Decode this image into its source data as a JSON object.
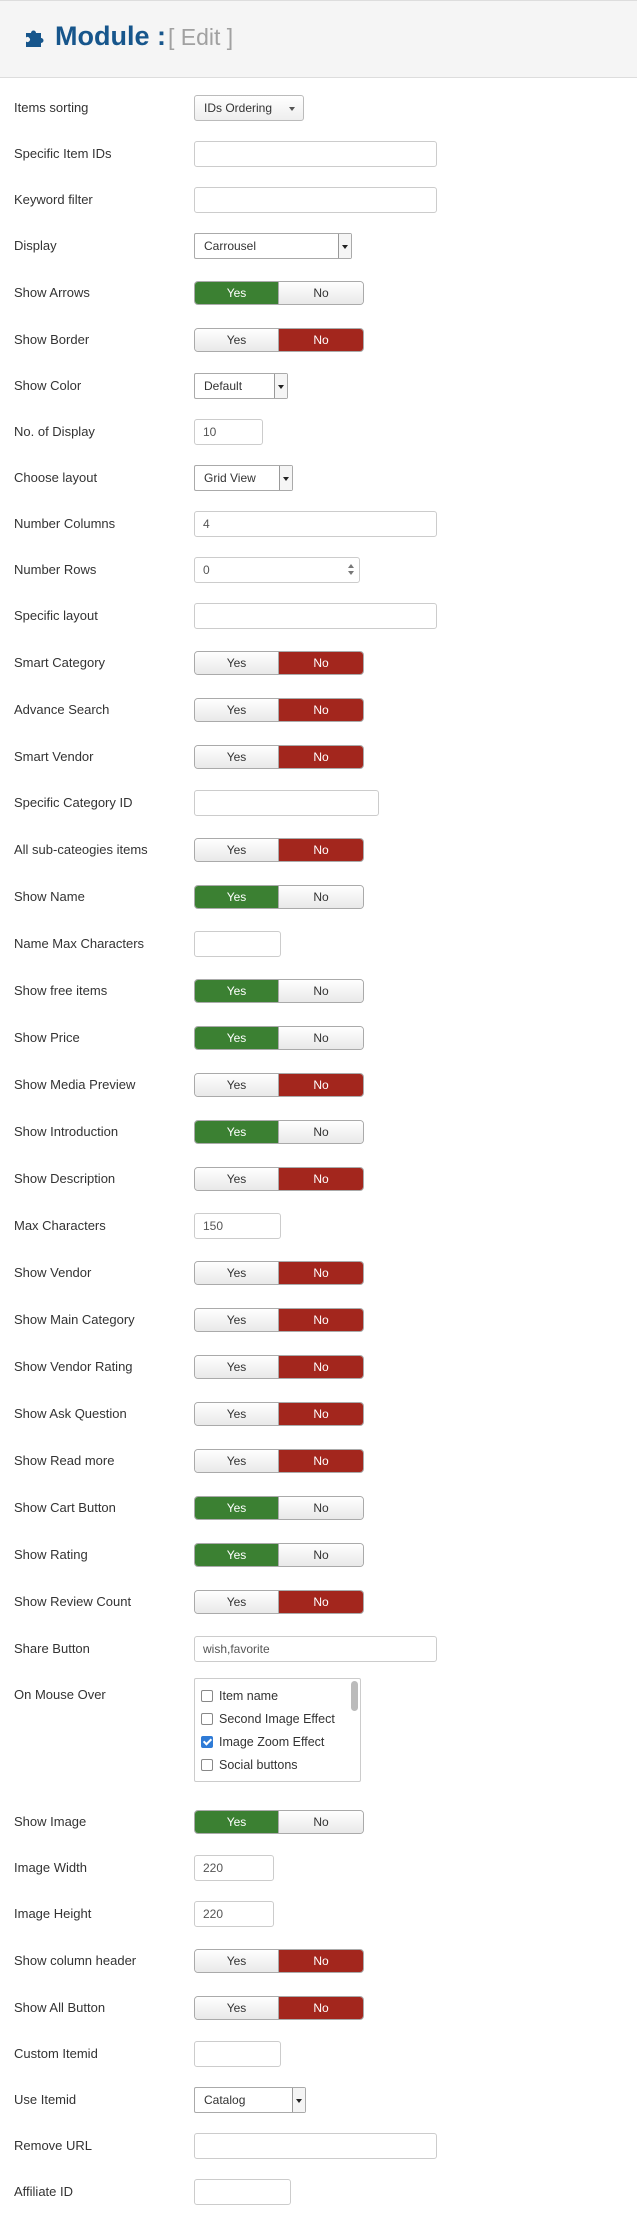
{
  "header": {
    "title": "Module :",
    "subtitle": "[ Edit ]"
  },
  "fields": {
    "items_sorting": {
      "label": "Items sorting",
      "value": "IDs Ordering"
    },
    "specific_item_ids": {
      "label": "Specific Item IDs",
      "value": ""
    },
    "keyword_filter": {
      "label": "Keyword filter",
      "value": ""
    },
    "display": {
      "label": "Display",
      "value": "Carrousel"
    },
    "show_arrows": {
      "label": "Show Arrows",
      "yes": "Yes",
      "no": "No",
      "selected": "Yes"
    },
    "show_border": {
      "label": "Show Border",
      "yes": "Yes",
      "no": "No",
      "selected": "No"
    },
    "show_color": {
      "label": "Show Color",
      "value": "Default"
    },
    "no_of_display": {
      "label": "No. of Display",
      "value": "10"
    },
    "choose_layout": {
      "label": "Choose layout",
      "value": "Grid View"
    },
    "number_columns": {
      "label": "Number Columns",
      "value": "4"
    },
    "number_rows": {
      "label": "Number Rows",
      "value": "0"
    },
    "specific_layout": {
      "label": "Specific layout",
      "value": ""
    },
    "smart_category": {
      "label": "Smart Category",
      "yes": "Yes",
      "no": "No",
      "selected": "No"
    },
    "advance_search": {
      "label": "Advance Search",
      "yes": "Yes",
      "no": "No",
      "selected": "No"
    },
    "smart_vendor": {
      "label": "Smart Vendor",
      "yes": "Yes",
      "no": "No",
      "selected": "No"
    },
    "specific_category_id": {
      "label": "Specific Category ID",
      "value": ""
    },
    "all_sub_categories": {
      "label": "All sub-cateogies items",
      "yes": "Yes",
      "no": "No",
      "selected": "No"
    },
    "show_name": {
      "label": "Show Name",
      "yes": "Yes",
      "no": "No",
      "selected": "Yes"
    },
    "name_max_characters": {
      "label": "Name Max Characters",
      "value": ""
    },
    "show_free_items": {
      "label": "Show free items",
      "yes": "Yes",
      "no": "No",
      "selected": "Yes"
    },
    "show_price": {
      "label": "Show Price",
      "yes": "Yes",
      "no": "No",
      "selected": "Yes"
    },
    "show_media_preview": {
      "label": "Show Media Preview",
      "yes": "Yes",
      "no": "No",
      "selected": "No"
    },
    "show_introduction": {
      "label": "Show Introduction",
      "yes": "Yes",
      "no": "No",
      "selected": "Yes"
    },
    "show_description": {
      "label": "Show Description",
      "yes": "Yes",
      "no": "No",
      "selected": "No"
    },
    "max_characters": {
      "label": "Max Characters",
      "value": "150"
    },
    "show_vendor": {
      "label": "Show Vendor",
      "yes": "Yes",
      "no": "No",
      "selected": "No"
    },
    "show_main_category": {
      "label": "Show Main Category",
      "yes": "Yes",
      "no": "No",
      "selected": "No"
    },
    "show_vendor_rating": {
      "label": "Show Vendor Rating",
      "yes": "Yes",
      "no": "No",
      "selected": "No"
    },
    "show_ask_question": {
      "label": "Show Ask Question",
      "yes": "Yes",
      "no": "No",
      "selected": "No"
    },
    "show_read_more": {
      "label": "Show Read more",
      "yes": "Yes",
      "no": "No",
      "selected": "No"
    },
    "show_cart_button": {
      "label": "Show Cart Button",
      "yes": "Yes",
      "no": "No",
      "selected": "Yes"
    },
    "show_rating": {
      "label": "Show Rating",
      "yes": "Yes",
      "no": "No",
      "selected": "Yes"
    },
    "show_review_count": {
      "label": "Show Review Count",
      "yes": "Yes",
      "no": "No",
      "selected": "No"
    },
    "share_button": {
      "label": "Share Button",
      "value": "wish,favorite"
    },
    "on_mouse_over": {
      "label": "On Mouse Over",
      "options": [
        {
          "label": "Item name",
          "checked": false
        },
        {
          "label": "Second Image Effect",
          "checked": false
        },
        {
          "label": "Image Zoom Effect",
          "checked": true
        },
        {
          "label": "Social buttons",
          "checked": false
        }
      ]
    },
    "show_image": {
      "label": "Show Image",
      "yes": "Yes",
      "no": "No",
      "selected": "Yes"
    },
    "image_width": {
      "label": "Image Width",
      "value": "220"
    },
    "image_height": {
      "label": "Image Height",
      "value": "220"
    },
    "show_column_header": {
      "label": "Show column header",
      "yes": "Yes",
      "no": "No",
      "selected": "No"
    },
    "show_all_button": {
      "label": "Show All Button",
      "yes": "Yes",
      "no": "No",
      "selected": "No"
    },
    "custom_itemid": {
      "label": "Custom Itemid",
      "value": ""
    },
    "use_itemid": {
      "label": "Use Itemid",
      "value": "Catalog"
    },
    "remove_url": {
      "label": "Remove URL",
      "value": ""
    },
    "affiliate_id": {
      "label": "Affiliate ID",
      "value": ""
    }
  },
  "colors": {
    "yes_active": "#3b8032",
    "no_active": "#a3261d",
    "title": "#17568c"
  }
}
